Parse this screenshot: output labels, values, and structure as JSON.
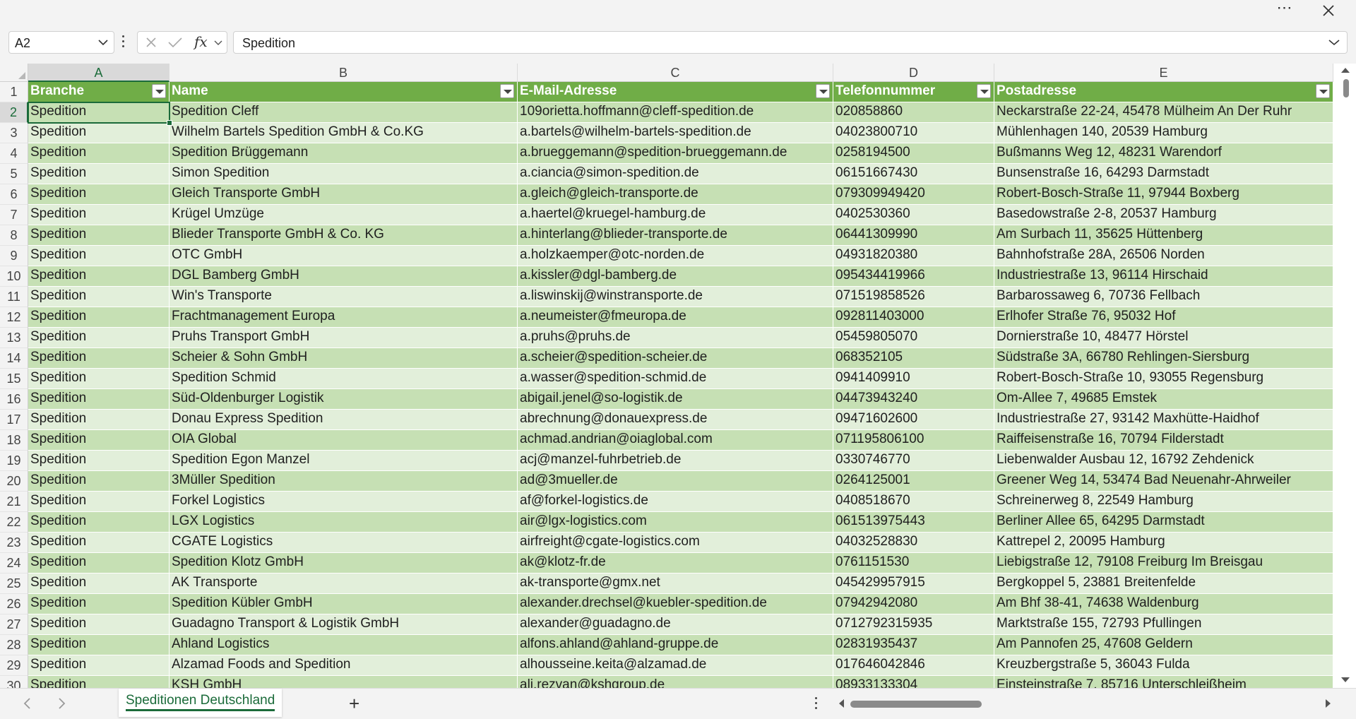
{
  "titlebar": {
    "more_label": "⋯"
  },
  "formula_bar": {
    "name_box": "A2",
    "fx_label": "fx",
    "content": "Spedition"
  },
  "columns": [
    "A",
    "B",
    "C",
    "D",
    "E"
  ],
  "header_row": [
    "Branche",
    "Name",
    "E-Mail-Adresse",
    "Telefonnummer",
    "Postadresse"
  ],
  "rows": [
    [
      "2",
      "Spedition",
      "Spedition Cleff",
      "109orietta.hoffmann@cleff-spedition.de",
      "020858860",
      "Neckarstraße 22-24, 45478 Mülheim An Der Ruhr"
    ],
    [
      "3",
      "Spedition",
      "Wilhelm Bartels Spedition GmbH & Co.KG",
      "a.bartels@wilhelm-bartels-spedition.de",
      "04023800710",
      "Mühlenhagen 140, 20539 Hamburg"
    ],
    [
      "4",
      "Spedition",
      "Spedition Brüggemann",
      "a.brueggemann@spedition-brueggemann.de",
      "0258194500",
      "Bußmanns Weg 12, 48231 Warendorf"
    ],
    [
      "5",
      "Spedition",
      "Simon Spedition",
      "a.ciancia@simon-spedition.de",
      "06151667430",
      "Bunsenstraße 16, 64293 Darmstadt"
    ],
    [
      "6",
      "Spedition",
      "Gleich Transporte GmbH",
      "a.gleich@gleich-transporte.de",
      "079309949420",
      "Robert-Bosch-Straße 11, 97944 Boxberg"
    ],
    [
      "7",
      "Spedition",
      "Krügel Umzüge",
      "a.haertel@kruegel-hamburg.de",
      "0402530360",
      "Basedowstraße 2-8, 20537 Hamburg"
    ],
    [
      "8",
      "Spedition",
      "Blieder Transporte GmbH & Co. KG",
      "a.hinterlang@blieder-transporte.de",
      "06441309990",
      "Am Surbach 11, 35625 Hüttenberg"
    ],
    [
      "9",
      "Spedition",
      "OTC GmbH",
      "a.holzkaemper@otc-norden.de",
      "04931820380",
      "Bahnhofstraße 28A, 26506 Norden"
    ],
    [
      "10",
      "Spedition",
      "DGL Bamberg GmbH",
      "a.kissler@dgl-bamberg.de",
      "095434419966",
      "Industriestraße 13, 96114 Hirschaid"
    ],
    [
      "11",
      "Spedition",
      "Win's Transporte",
      "a.liswinskij@winstransporte.de",
      "071519858526",
      "Barbarossaweg 6, 70736 Fellbach"
    ],
    [
      "12",
      "Spedition",
      "Frachtmanagement Europa",
      "a.neumeister@fmeuropa.de",
      "092811403000",
      "Erlhofer Straße 76, 95032 Hof"
    ],
    [
      "13",
      "Spedition",
      "Pruhs Transport GmbH",
      "a.pruhs@pruhs.de",
      "05459805070",
      "Dornierstraße 10, 48477 Hörstel"
    ],
    [
      "14",
      "Spedition",
      "Scheier & Sohn GmbH",
      "a.scheier@spedition-scheier.de",
      "068352105",
      "Südstraße 3A, 66780 Rehlingen-Siersburg"
    ],
    [
      "15",
      "Spedition",
      "Spedition Schmid",
      "a.wasser@spedition-schmid.de",
      "0941409910",
      "Robert-Bosch-Straße 10, 93055 Regensburg"
    ],
    [
      "16",
      "Spedition",
      "Süd-Oldenburger Logistik",
      "abigail.jenel@so-logistik.de",
      "04473943240",
      "Om-Allee 7, 49685 Emstek"
    ],
    [
      "17",
      "Spedition",
      "Donau Express Spedition",
      "abrechnung@donauexpress.de",
      "09471602600",
      "Industriestraße 27, 93142 Maxhütte-Haidhof"
    ],
    [
      "18",
      "Spedition",
      "OIA Global",
      "achmad.andrian@oiaglobal.com",
      "071195806100",
      "Raiffeisenstraße 16, 70794 Filderstadt"
    ],
    [
      "19",
      "Spedition",
      "Spedition Egon Manzel",
      "acj@manzel-fuhrbetrieb.de",
      "0330746770",
      "Liebenwalder Ausbau 12, 16792 Zehdenick"
    ],
    [
      "20",
      "Spedition",
      "3Müller Spedition",
      "ad@3mueller.de",
      "0264125001",
      "Greener Weg 14, 53474 Bad Neuenahr-Ahrweiler"
    ],
    [
      "21",
      "Spedition",
      "Forkel Logistics",
      "af@forkel-logistics.de",
      "0408518670",
      "Schreinerweg 8, 22549 Hamburg"
    ],
    [
      "22",
      "Spedition",
      "LGX Logistics",
      "air@lgx-logistics.com",
      "061513975443",
      "Berliner Allee 65, 64295 Darmstadt"
    ],
    [
      "23",
      "Spedition",
      "CGATE Logistics",
      "airfreight@cgate-logistics.com",
      "04032528830",
      "Kattrepel 2, 20095 Hamburg"
    ],
    [
      "24",
      "Spedition",
      "Spedition Klotz GmbH",
      "ak@klotz-fr.de",
      "0761151530",
      "Liebigstraße 12, 79108 Freiburg Im Breisgau"
    ],
    [
      "25",
      "Spedition",
      "AK Transporte",
      "ak-transporte@gmx.net",
      "045429957915",
      "Bergkoppel 5, 23881 Breitenfelde"
    ],
    [
      "26",
      "Spedition",
      "Spedition Kübler GmbH",
      "alexander.drechsel@kuebler-spedition.de",
      "07942942080",
      "Am Bhf 38-41, 74638 Waldenburg"
    ],
    [
      "27",
      "Spedition",
      "Guadagno Transport & Logistik GmbH",
      "alexander@guadagno.de",
      "0712792315935",
      "Marktstraße 155, 72793 Pfullingen"
    ],
    [
      "28",
      "Spedition",
      "Ahland Logistics",
      "alfons.ahland@ahland-gruppe.de",
      "02831935437",
      "Am Pannofen 25, 47608 Geldern"
    ],
    [
      "29",
      "Spedition",
      "Alzamad Foods and Spedition",
      "alhousseine.keita@alzamad.de",
      "017646042846",
      "Kreuzbergstraße 5, 36043 Fulda"
    ],
    [
      "30",
      "Spedition",
      "KSH GmbH",
      "ali.rezvan@kshgroup.de",
      "08933133304",
      "Einsteinstraße 7, 85716 Unterschleißheim"
    ]
  ],
  "sheet_tabs": [
    "Speditionen Deutschland"
  ],
  "add_sheet_label": "+",
  "colors": {
    "header_fill": "#70ad47",
    "band_light": "#e2efda",
    "band_dark": "#c6e0b4",
    "accent": "#1b6b3a"
  }
}
